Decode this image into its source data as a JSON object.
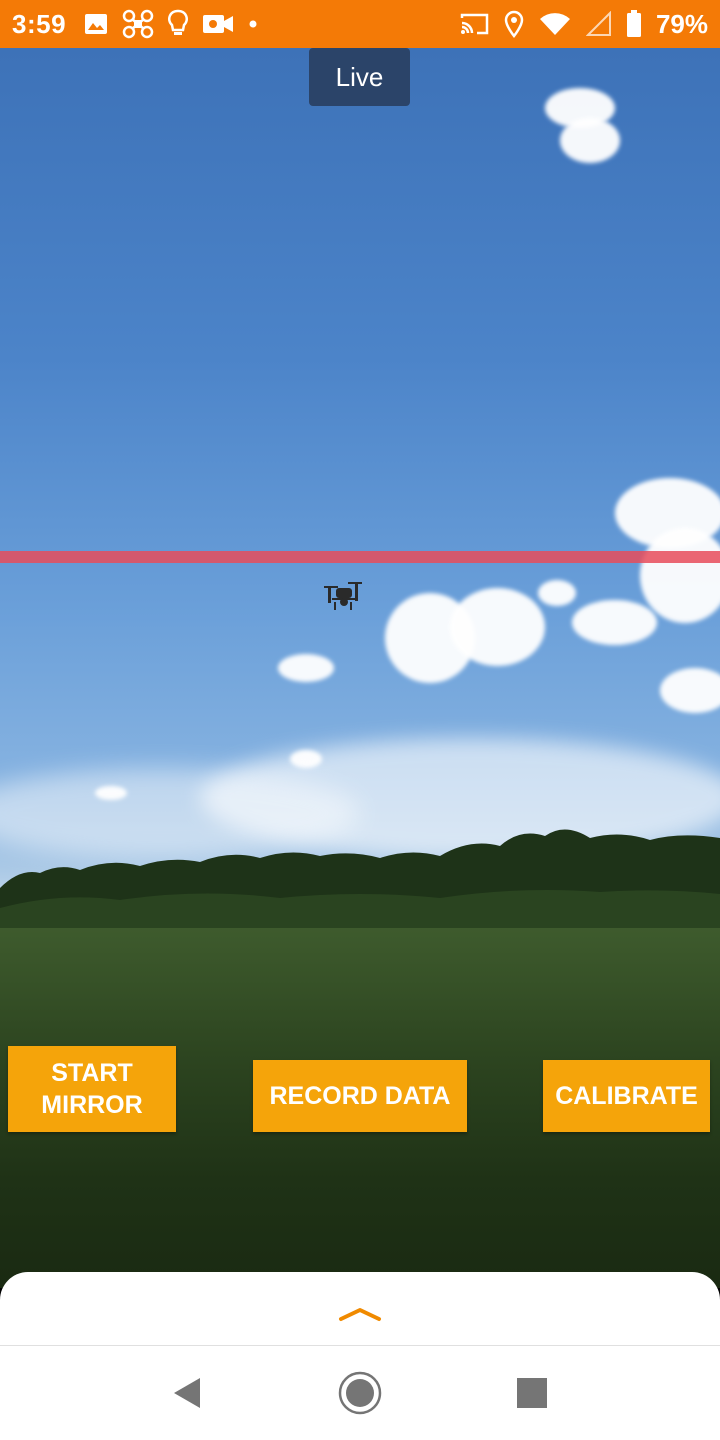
{
  "status_bar": {
    "time": "3:59",
    "battery_percent": "79%",
    "left_icons": [
      "image-icon",
      "drone-icon",
      "lightbulb-icon",
      "video-camera-icon",
      "dot-icon"
    ],
    "right_icons": [
      "cast-icon",
      "location-icon",
      "wifi-icon",
      "signal-icon",
      "battery-icon"
    ]
  },
  "camera": {
    "live_label": "Live"
  },
  "actions": {
    "start_mirror_line1": "START",
    "start_mirror_line2": "MIRROR",
    "record_data": "RECORD DATA",
    "calibrate": "CALIBRATE"
  },
  "bottom_sheet": {
    "handle_icon": "chevron-up-icon"
  },
  "nav": {
    "back": "back-icon",
    "home": "home-icon",
    "recents": "recents-icon"
  },
  "colors": {
    "status_bar": "#f47a06",
    "button": "#f5a40a",
    "horizon_line": "#e84c5a",
    "chevron": "#f08a00"
  }
}
